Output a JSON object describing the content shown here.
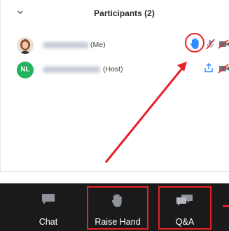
{
  "panel": {
    "title": "Participants (2)",
    "collapse_icon": "chevron-down-icon"
  },
  "participants": [
    {
      "name_redacted": true,
      "role": "(Me)",
      "avatar": "photo",
      "status_icon": "raised-hand-icon",
      "mic": "mic-muted-icon",
      "video": "video-off-icon"
    },
    {
      "name_redacted": true,
      "initials": "NL",
      "role": "(Host)",
      "avatar_color": "#23b25d",
      "status_icon": "share-icon",
      "mic": "mic-muted-icon",
      "video": "video-off-icon"
    }
  ],
  "toolbar": {
    "chat_label": "Chat",
    "raise_label": "Raise Hand",
    "qa_label": "Q&A"
  },
  "colors": {
    "accent_blue": "#2d8cff",
    "annotation_red": "#e8202a",
    "toolbar_bg": "#1a1a1a",
    "icon_gray": "#9aa0a6"
  }
}
